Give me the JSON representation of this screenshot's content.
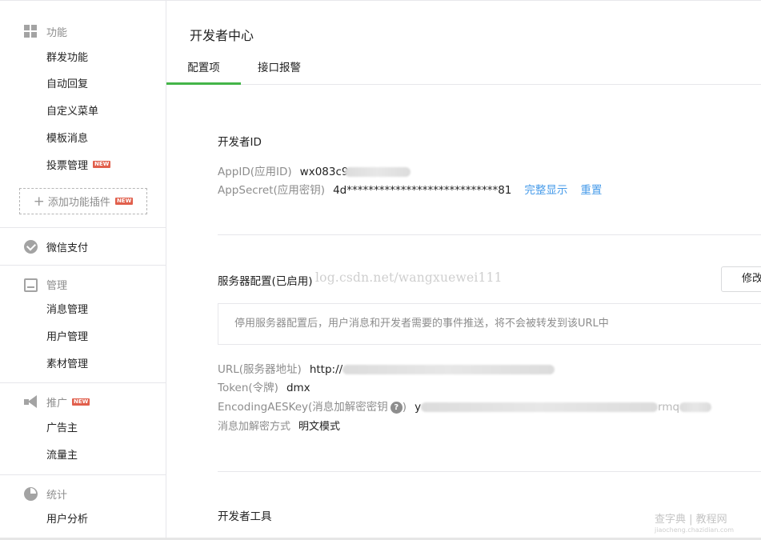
{
  "sidebar": {
    "sections": [
      {
        "title": "功能",
        "icon": "grid-icon"
      },
      {
        "title": "微信支付",
        "icon": "wechat-pay-icon"
      },
      {
        "title": "管理",
        "icon": "inbox-icon"
      },
      {
        "title": "推广",
        "icon": "megaphone-icon",
        "badge": "NEW"
      },
      {
        "title": "统计",
        "icon": "pie-chart-icon"
      }
    ],
    "function_items": [
      "群发功能",
      "自动回复",
      "自定义菜单",
      "模板消息",
      "投票管理"
    ],
    "vote_badge": "NEW",
    "add_plugin": "添加功能插件",
    "add_plugin_badge": "NEW",
    "manage_items": [
      "消息管理",
      "用户管理",
      "素材管理"
    ],
    "promote_items": [
      "广告主",
      "流量主"
    ],
    "stats_items": [
      "用户分析"
    ]
  },
  "main": {
    "title": "开发者中心",
    "tabs": [
      {
        "label": "配置项",
        "active": true
      },
      {
        "label": "接口报警",
        "active": false
      }
    ],
    "developer_id": {
      "title": "开发者ID",
      "appid_label": "AppID(应用ID)",
      "appid_value": "wx083c9",
      "appsecret_label": "AppSecret(应用密钥)",
      "appsecret_value": "4d****************************81",
      "show_full": "完整显示",
      "reset": "重置"
    },
    "server_config": {
      "title": "服务器配置(已启用)",
      "edit_button": "修改",
      "notice": "停用服务器配置后，用户消息和开发者需要的事件推送，将不会被转发到该URL中",
      "url_label": "URL(服务器地址)",
      "url_value": "http://",
      "token_label": "Token(令牌)",
      "token_value": "dmx",
      "aes_label": "EncodingAESKey(消息加解密密钥",
      "aes_help": "?",
      "aes_label_close": ")",
      "aes_value_start": "y",
      "aes_value_end": "rmq",
      "mode_label": "消息加解密方式",
      "mode_value": "明文模式"
    },
    "dev_tools": {
      "title": "开发者工具"
    }
  },
  "watermark": "log.csdn.net/wangxuewei111",
  "corner_watermark": {
    "line1": "查字典 | 教程网",
    "line2": "jiaocheng.chazidian.com"
  },
  "colors": {
    "accent_green": "#44b549",
    "link_blue": "#459ae9",
    "badge_red": "#e15f4c"
  }
}
